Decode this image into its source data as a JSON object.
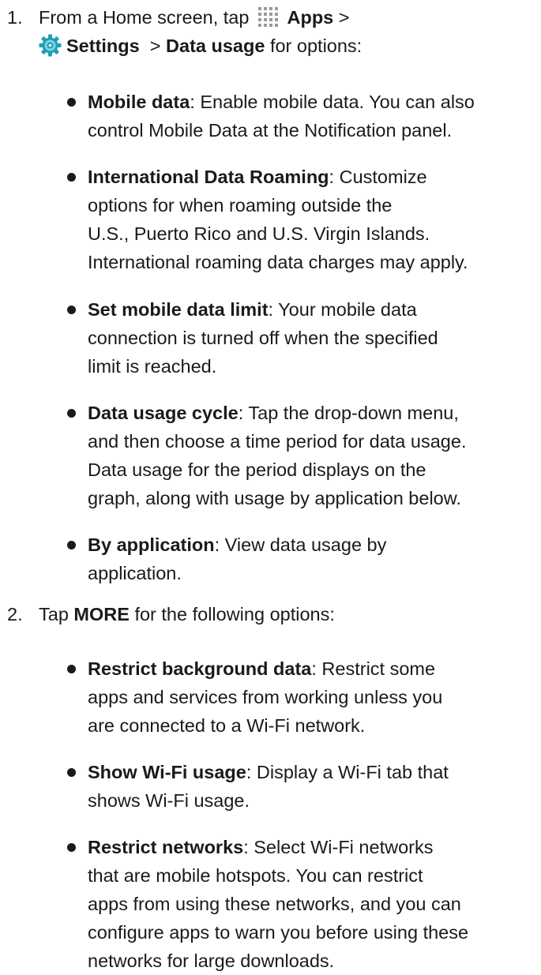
{
  "step1": {
    "number": "1.",
    "line1_prefix": "From a Home screen, tap",
    "apps_icon": "apps-grid-icon",
    "apps_label": "Apps",
    "line1_suffix": " >",
    "settings_icon": "settings-gear-icon",
    "settings_label": "Settings",
    "line2_mid": "  > ",
    "data_usage_label": "Data usage",
    "line2_suffix": " for options:",
    "bullets": [
      {
        "term": "Mobile data",
        "lines": [
          ": Enable mobile data. You can also",
          "control Mobile Data at the Notification panel."
        ]
      },
      {
        "term": "International Data Roaming",
        "lines": [
          ": Customize",
          "options for when roaming outside the",
          "U.S., Puerto Rico and U.S. Virgin Islands.",
          "International roaming data charges may apply."
        ]
      },
      {
        "term": "Set mobile data limit",
        "lines": [
          ": Your mobile data",
          "connection is turned off when the specified",
          "limit is reached."
        ]
      },
      {
        "term": "Data usage cycle",
        "lines": [
          ": Tap the drop-down menu,",
          "and then choose a time period for data usage.",
          "Data usage for the period displays on the",
          "graph, along with usage by application below."
        ]
      },
      {
        "term": "By application",
        "lines": [
          ": View data usage by",
          "application."
        ]
      }
    ]
  },
  "step2": {
    "number": "2.",
    "prefix": "Tap ",
    "more_label": "MORE",
    "suffix": " for the following options:",
    "bullets": [
      {
        "term": "Restrict background data",
        "lines": [
          ": Restrict some",
          "apps and services from working unless you",
          "are connected to a Wi-Fi network."
        ]
      },
      {
        "term": "Show Wi-Fi usage",
        "lines": [
          ": Display a Wi-Fi tab that",
          "shows Wi-Fi usage."
        ]
      },
      {
        "term": "Restrict networks",
        "lines": [
          ": Select Wi-Fi networks",
          "that are mobile hotspots. You can restrict",
          "apps from using these networks, and you can",
          "configure apps to warn you before using these",
          "networks for large downloads."
        ]
      }
    ]
  },
  "colors": {
    "text": "#1a1a1a",
    "apps_icon_dots": "#9a9a9a",
    "settings_icon_teal": "#1f9fb4",
    "settings_icon_inner": "#7fd3e0"
  }
}
